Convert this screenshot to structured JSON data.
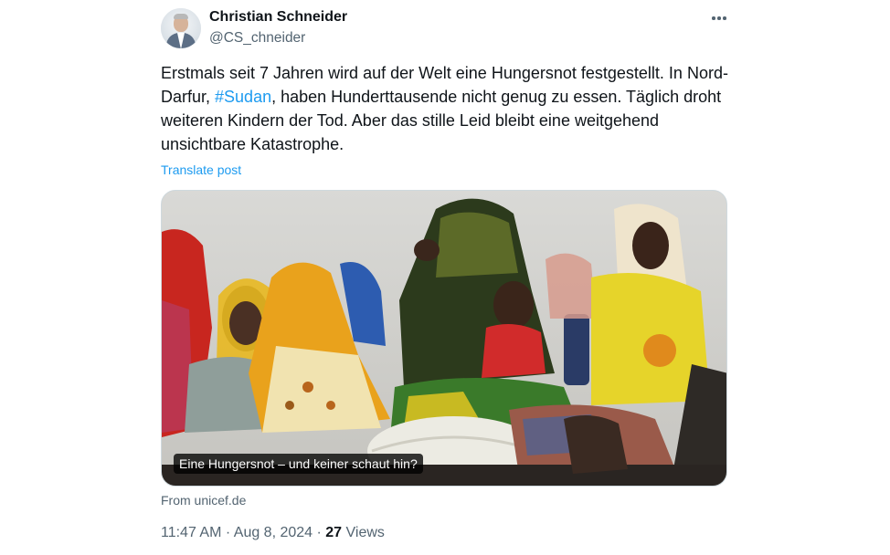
{
  "author": {
    "name": "Christian Schneider",
    "handle": "@CS_chneider"
  },
  "tweet": {
    "text_part1": "Erstmals seit 7 Jahren wird auf der Welt eine Hungersnot festgestellt. In Nord-Darfur, ",
    "hashtag": "#Sudan",
    "text_part2": ", haben Hunderttausende nicht genug zu essen. Täglich droht weiteren Kindern der Tod. Aber das stille Leid bleibt eine weitgehend unsichtbare Katastrophe.",
    "translate_label": "Translate post"
  },
  "card": {
    "caption": "Eine Hungersnot – und keiner schaut hin?",
    "source": "From unicef.de"
  },
  "meta": {
    "time": "11:47 AM",
    "separator1": " · ",
    "date": "Aug 8, 2024",
    "separator2": " · ",
    "views_count": "27",
    "views_label": " Views"
  },
  "icons": {
    "more": "more-horizontal-icon",
    "avatar": "profile-photo"
  },
  "colors": {
    "link": "#1d9bf0",
    "secondary_text": "#536471",
    "primary_text": "#0f1419",
    "border": "#cfd9de"
  }
}
